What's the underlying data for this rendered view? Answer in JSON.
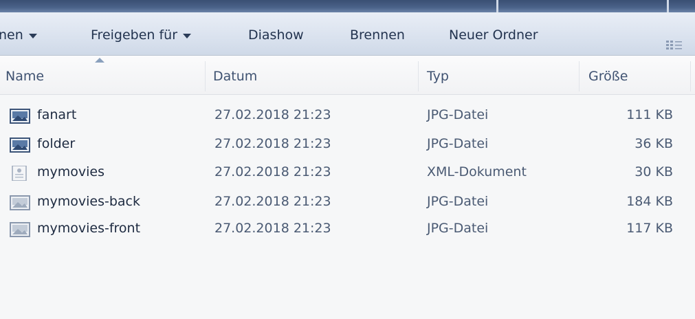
{
  "toolbar": {
    "items": [
      {
        "label": "nen",
        "has_dropdown": true
      },
      {
        "label": "Freigeben für",
        "has_dropdown": true
      },
      {
        "label": "Diashow",
        "has_dropdown": false
      },
      {
        "label": "Brennen",
        "has_dropdown": false
      },
      {
        "label": "Neuer Ordner",
        "has_dropdown": false
      }
    ],
    "view_icon": "view-details-icon"
  },
  "columns": {
    "name": "Name",
    "date": "Datum",
    "type": "Typ",
    "size": "Größe"
  },
  "files": [
    {
      "name": "fanart",
      "date": "27.02.2018 21:23",
      "type": "JPG-Datei",
      "size": "111 KB",
      "icon": "jpg-file-icon"
    },
    {
      "name": "folder",
      "date": "27.02.2018 21:23",
      "type": "JPG-Datei",
      "size": "36 KB",
      "icon": "jpg-file-icon"
    },
    {
      "name": "mymovies",
      "date": "27.02.2018 21:23",
      "type": "XML-Dokument",
      "size": "30 KB",
      "icon": "xml-file-icon"
    },
    {
      "name": "mymovies-back",
      "date": "27.02.2018 21:23",
      "type": "JPG-Datei",
      "size": "184 KB",
      "icon": "jpg-file-icon"
    },
    {
      "name": "mymovies-front",
      "date": "27.02.2018 21:23",
      "type": "JPG-Datei",
      "size": "117 KB",
      "icon": "jpg-file-icon"
    }
  ]
}
